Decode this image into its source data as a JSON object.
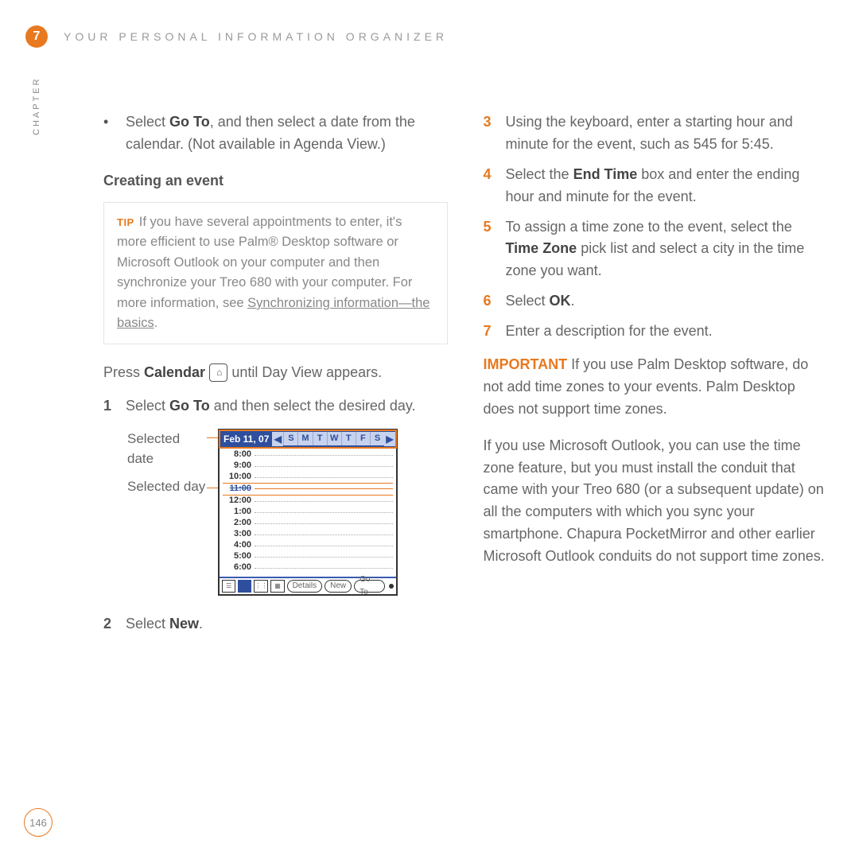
{
  "chapter_number": "7",
  "chapter_label": "CHAPTER",
  "header_title": "YOUR PERSONAL INFORMATION ORGANIZER",
  "page_number": "146",
  "left": {
    "bullet_prefix": "•",
    "bullet_pre": "Select ",
    "bullet_bold1": "Go To",
    "bullet_post": ", and then select a date from the calendar. (Not available in Agenda View.)",
    "section_heading": "Creating an event",
    "tip_label": "TIP",
    "tip_body": "If you have several appointments to enter, it's more efficient to use Palm® Desktop software or Microsoft Outlook on your computer and then synchronize your Treo 680 with your computer. For more information, see ",
    "tip_link": "Synchronizing information—the basics",
    "tip_period": ".",
    "press_pre": "Press ",
    "press_bold": "Calendar",
    "press_icon": "⌂",
    "press_post": " until Day View appears.",
    "step1_num": "1",
    "step1_pre": "Select ",
    "step1_bold": "Go To",
    "step1_post": " and then select the desired day.",
    "callout1": "Selected date",
    "callout2": "Selected day",
    "step2_num": "2",
    "step2_pre": "Select ",
    "step2_bold": "New",
    "step2_post": "."
  },
  "right": {
    "s3_num": "3",
    "s3_text": "Using the keyboard, enter a starting hour and minute for the event, such as 545 for 5:45.",
    "s4_num": "4",
    "s4_pre": "Select the ",
    "s4_bold": "End Time",
    "s4_post": " box and enter the ending hour and minute for the event.",
    "s5_num": "5",
    "s5_pre": "To assign a time zone to the event, select the ",
    "s5_bold": "Time Zone",
    "s5_post": " pick list and select a city in the time zone you want.",
    "s6_num": "6",
    "s6_pre": "Select ",
    "s6_bold": "OK",
    "s6_post": ".",
    "s7_num": "7",
    "s7_text": "Enter a description for the event.",
    "important_label": "IMPORTANT",
    "important_text": " If you use Palm Desktop software, do not add time zones to your events. Palm Desktop does not support time zones.",
    "para2": "If you use Microsoft Outlook, you can use the time zone feature, but you must install the conduit that came with your Treo 680 (or a subsequent update) on all the computers with which you sync your smartphone. Chapura PocketMirror and other earlier Microsoft Outlook conduits do not support time zones."
  },
  "screenshot": {
    "date": "Feb 11, 07",
    "days": [
      "S",
      "M",
      "T",
      "W",
      "T",
      "F",
      "S"
    ],
    "times": [
      "8:00",
      "9:00",
      "10:00",
      "11:00",
      "12:00",
      "1:00",
      "2:00",
      "3:00",
      "4:00",
      "5:00",
      "6:00"
    ],
    "btn_details": "Details",
    "btn_new": "New",
    "btn_goto": "Go To"
  }
}
